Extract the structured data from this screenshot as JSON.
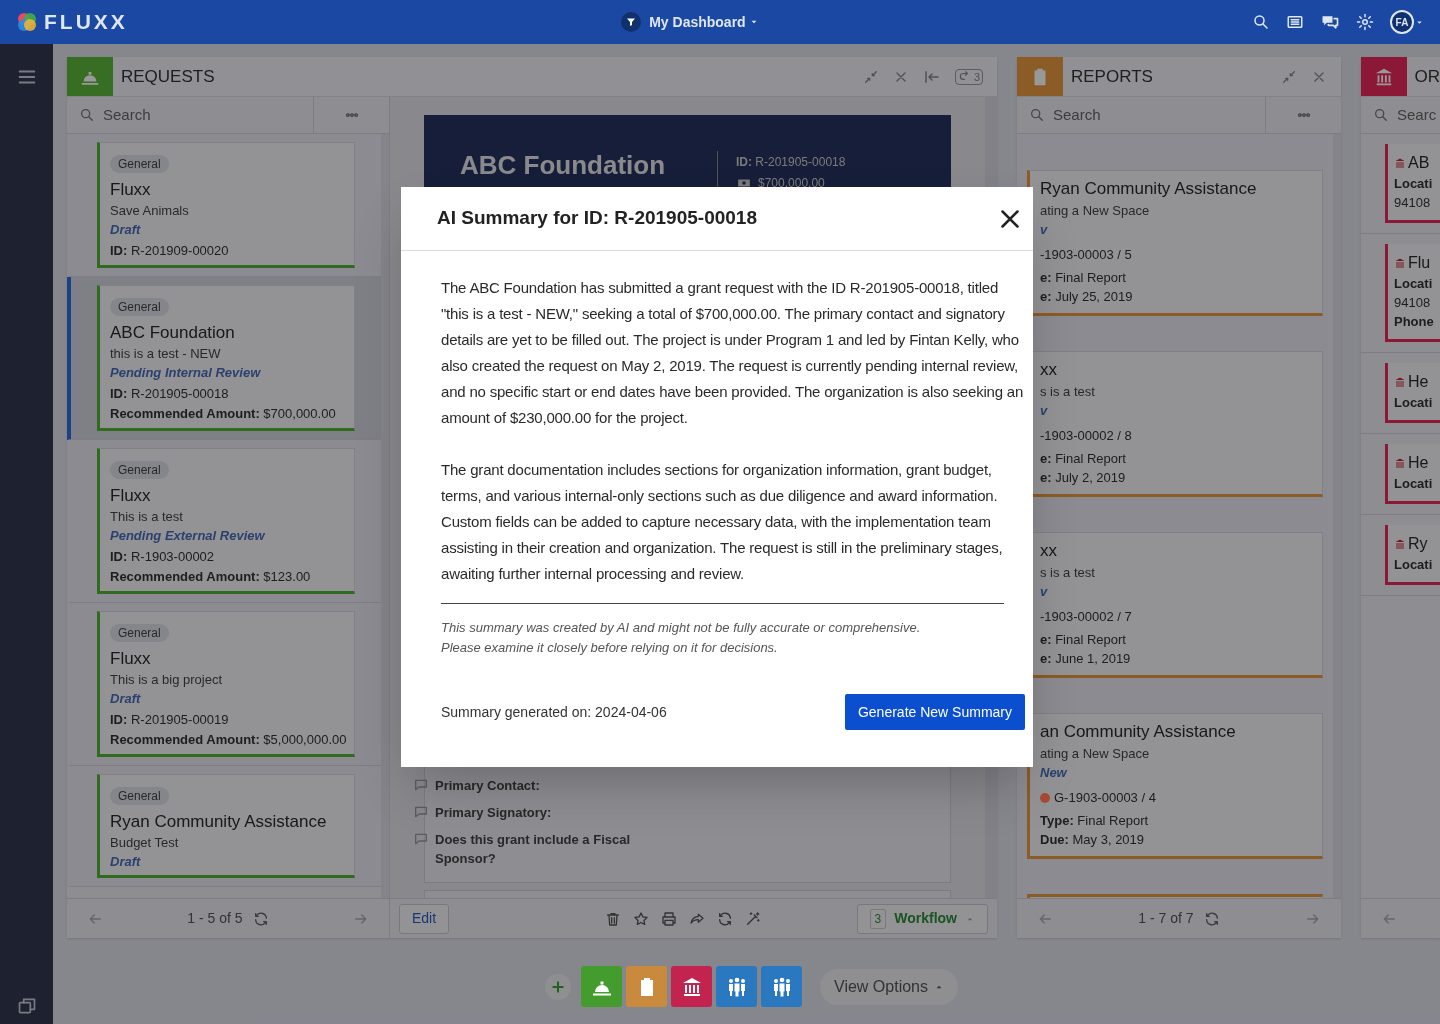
{
  "top_bar": {
    "brand": "FLUXX",
    "dashboard": "My Dashboard",
    "avatar": "FA"
  },
  "requests_panel": {
    "title": "REQUESTS",
    "badge": "3",
    "search": {
      "placeholder": "Search"
    },
    "cards": [
      {
        "tag": "General",
        "title": "Fluxx",
        "subtitle": "Save Animals",
        "status": "Draft",
        "id": "**ID:** R-201909-00020",
        "selected": false
      },
      {
        "tag": "General",
        "title": "ABC Foundation",
        "subtitle": "this is a test - NEW",
        "status": "Pending Internal Review",
        "id": "**ID:** R-201905-00018",
        "amount": "**Recommended Amount:** $700,000.00",
        "selected": true
      },
      {
        "tag": "General",
        "title": "Fluxx",
        "subtitle": "This is a test",
        "status": "Pending External Review",
        "id": "**ID:** R-1903-00002",
        "amount": "**Recommended Amount:** $123.00",
        "selected": false
      },
      {
        "tag": "General",
        "title": "Fluxx",
        "subtitle": "This is a big project",
        "status": "Draft",
        "id": "**ID:** R-201905-00019",
        "amount": "**Recommended Amount:** $5,000,000.00",
        "selected": false
      },
      {
        "tag": "General",
        "title": "Ryan Community Assistance",
        "subtitle": "Budget Test",
        "status": "Draft",
        "selected": false
      }
    ],
    "pagination": "1 - 5 of 5",
    "detail": {
      "title": "ABC Foundation",
      "id": "**ID:** R-201905-00018",
      "amount": "$700,000.00",
      "fields": [
        "Primary Contact:",
        "Primary Signatory:",
        "Does this grant include a Fiscal Sponsor?"
      ],
      "edit": "Edit",
      "workflow_count": "3",
      "workflow": "Workflow"
    }
  },
  "reports_panel": {
    "title": "REPORTS",
    "search": {
      "placeholder": "Search"
    },
    "cards": [
      {
        "title": "Ryan Community Assistance",
        "subtitle": "ating a New Space",
        "status": "v",
        "ref": "-1903-00003 / 5",
        "type": "**e:** Final Report",
        "due": "**e:** July 25, 2019"
      },
      {
        "title": "xx",
        "subtitle": "s is a test",
        "status": "v",
        "ref": "-1903-00002 / 8",
        "type": "**e:** Final Report",
        "due": "**e:** July 2, 2019"
      },
      {
        "title": "xx",
        "subtitle": "s is a test",
        "status": "v",
        "ref": "-1903-00002 / 7",
        "type": "**e:** Final Report",
        "due": "**e:** June 1, 2019"
      },
      {
        "title": "an Community Assistance",
        "subtitle": "ating a New Space",
        "status": "New",
        "color": "#a84a35",
        "ref": "G-1903-00003 / 4",
        "type": "**Type:** Final Report",
        "due": "**Due:** May 3, 2019"
      }
    ],
    "pagination": "1 - 7 of 7"
  },
  "panel_3": {
    "title": "OR",
    "search": {
      "placeholder": "Searc"
    },
    "cards": [
      {
        "title": "AB",
        "lines": [
          {
            "kind": "label",
            "text": "Locati"
          },
          {
            "kind": "value",
            "text": "94108"
          }
        ]
      },
      {
        "title": "Flu",
        "lines": [
          {
            "kind": "label",
            "text": "Locati"
          },
          {
            "kind": "value",
            "text": "94108"
          },
          {
            "kind": "label",
            "text": "Phone"
          }
        ]
      },
      {
        "title": "He",
        "lines": [
          {
            "kind": "label",
            "text": "Locati"
          }
        ]
      },
      {
        "title": "He",
        "lines": [
          {
            "kind": "label",
            "text": "Locati"
          }
        ]
      },
      {
        "title": "Ry",
        "lines": [
          {
            "kind": "label",
            "text": "Locati"
          }
        ]
      }
    ]
  },
  "dock": {
    "items": [
      {
        "kind": "request",
        "color": "#449c2e"
      },
      {
        "kind": "report",
        "color": "#c98a3e"
      },
      {
        "kind": "organization",
        "color": "#c2234f"
      },
      {
        "kind": "people",
        "color": "#2a78c0"
      },
      {
        "kind": "people",
        "color": "#2a78c0"
      }
    ],
    "view_options": "View Options"
  },
  "modal": {
    "title": "AI Summary for ID: R-201905-00018",
    "paragraphs": [
      "The ABC Foundation has submitted a grant request with the ID R-201905-00018, titled \"this is a test - NEW,\" seeking a total of $700,000.00. The primary contact and signatory details are yet to be filled out. The project is under Program 1 and led by Fintan Kelly, who also created the request on May 2, 2019. The request is currently pending internal review, and no specific start or end dates have been provided. The organization is also seeking an amount of $230,000.00 for the project.",
      "The grant documentation includes sections for organization information, grant budget, terms, and various internal-only sections such as due diligence and award information. Custom fields can be added to capture necessary data, with the implementation team assisting in their creation and organization. The request is still in the preliminary stages, awaiting further internal processing and review."
    ],
    "disclaimer": [
      "This summary was created by AI and might not be fully accurate or comprehensive.",
      "Please examine it closely before relying on it for decisions."
    ],
    "generated": "Summary generated on: 2024-04-06",
    "button": "Generate New Summary"
  }
}
